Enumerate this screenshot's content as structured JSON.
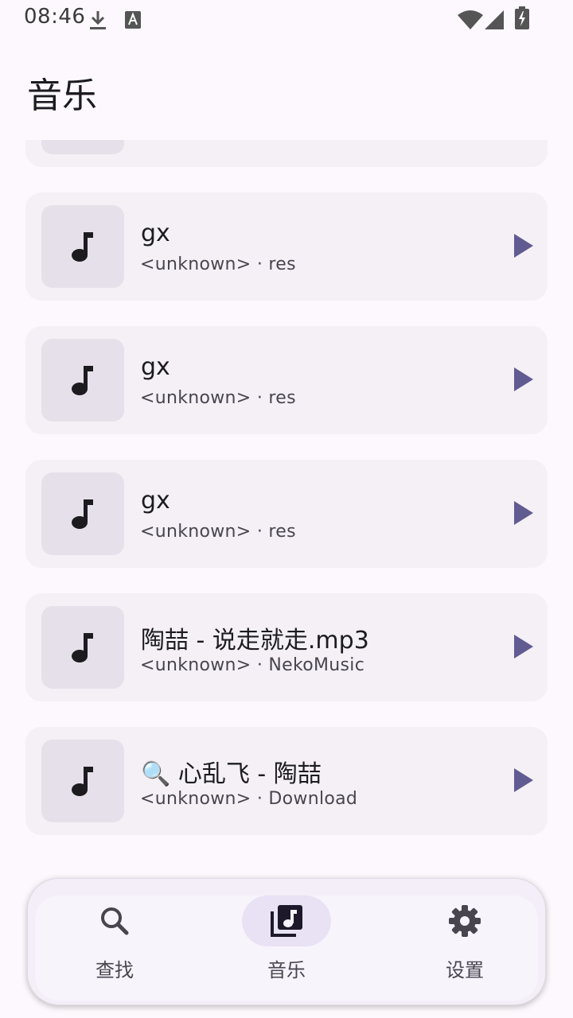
{
  "status": {
    "time": "08:46",
    "icons": [
      "download-icon",
      "a-badge-icon",
      "wifi-icon",
      "signal-icon",
      "battery-charging-icon"
    ]
  },
  "page": {
    "title": "音乐"
  },
  "songs": [
    {
      "title": "gx",
      "subtitle": "<unknown> · res"
    },
    {
      "title": "gx",
      "subtitle": "<unknown> · res"
    },
    {
      "title": "gx",
      "subtitle": "<unknown> · res"
    },
    {
      "title": "陶喆 - 说走就走.mp3",
      "subtitle": "<unknown> · NekoMusic"
    },
    {
      "title": "🔍 心乱飞 - 陶喆",
      "subtitle": "<unknown> · Download"
    }
  ],
  "nav": {
    "items": [
      {
        "label": "查找",
        "icon": "search-icon",
        "active": false
      },
      {
        "label": "音乐",
        "icon": "music-library-icon",
        "active": true
      },
      {
        "label": "设置",
        "icon": "gear-icon",
        "active": false
      }
    ]
  },
  "colors": {
    "accent": "#625b92",
    "background": "#fcf8fd",
    "card": "#f4f0f6",
    "art": "#e6e0ea",
    "active_pill": "#e9e2f5"
  }
}
